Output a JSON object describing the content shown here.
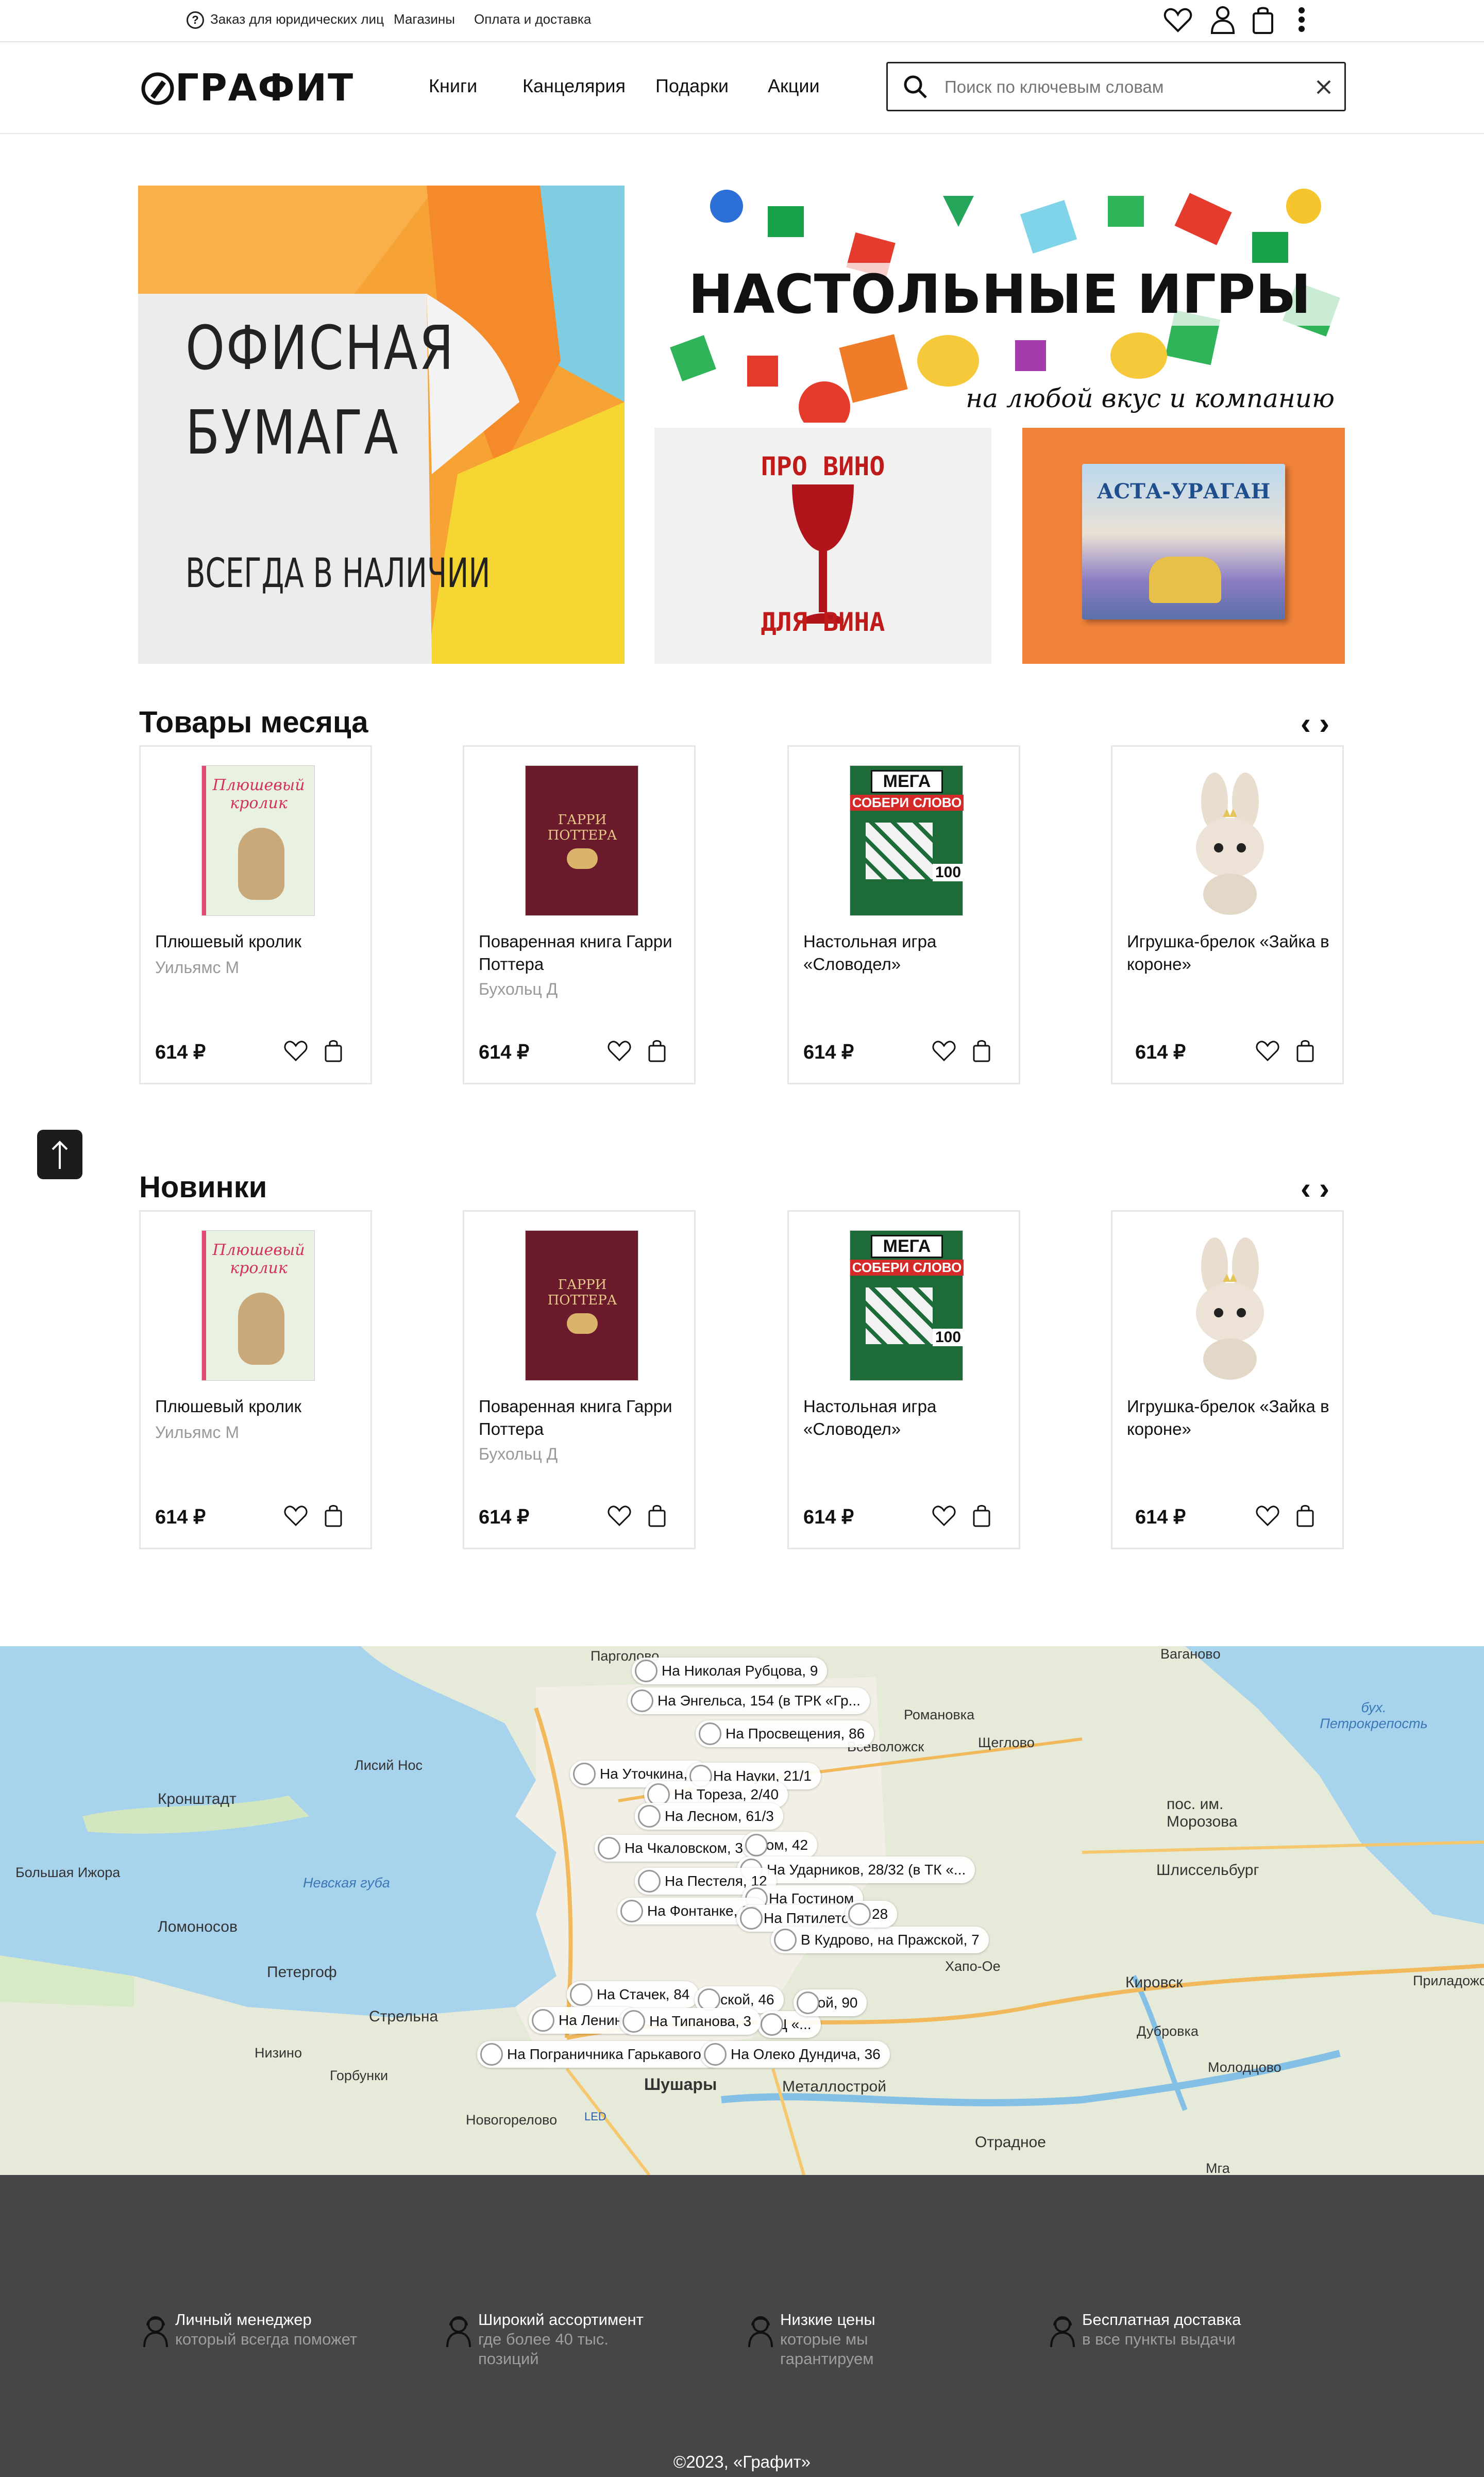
{
  "topbar": {
    "links": [
      "Заказ для юридических лиц",
      "Магазины",
      "Оплата и доставка"
    ]
  },
  "header": {
    "logo": "ГРАФИТ",
    "nav": [
      "Книги",
      "Канцелярия",
      "Подарки",
      "Акции"
    ],
    "search_placeholder": "Поиск по ключевым словам"
  },
  "banners": {
    "paper": {
      "line1": "ОФИСНАЯ",
      "line2": "БУМАГА",
      "line3": "ВСЕГДА В НАЛИЧИИ"
    },
    "games": {
      "title": "НАСТОЛЬНЫЕ ИГРЫ",
      "subtitle": "на любой вкус и компанию"
    },
    "wine": {
      "top": "ПРО ВИНО",
      "bottom": "ДЛЯ ВИНА"
    },
    "book": {
      "title": "АСТА-УРАГАН"
    }
  },
  "sections": [
    {
      "title": "Товары месяца",
      "products": [
        {
          "name": "Плюшевый кролик",
          "author": "Уильямс М",
          "price": "614 ₽",
          "cover_title": "Плюшевый кролик"
        },
        {
          "name": "Поваренная книга Гарри Поттера",
          "author": "Бухольц Д",
          "price": "614 ₽",
          "cover_title": "ГАРРИ ПОТТЕРА"
        },
        {
          "name": "Настольная игра «Словодел»",
          "author": "",
          "price": "614 ₽",
          "cover_title": "МЕГА",
          "cover_sub": "СОБЕРИ СЛОВО",
          "cover_num": "100"
        },
        {
          "name": "Игрушка-брелок «Зайка в короне»",
          "author": "",
          "price": "614 ₽"
        }
      ]
    },
    {
      "title": "Новинки",
      "products": [
        {
          "name": "Плюшевый кролик",
          "author": "Уильямс М",
          "price": "614 ₽",
          "cover_title": "Плюшевый кролик"
        },
        {
          "name": "Поваренная книга Гарри Поттера",
          "author": "Бухольц Д",
          "price": "614 ₽",
          "cover_title": "ГАРРИ ПОТТЕРА"
        },
        {
          "name": "Настольная игра «Словодел»",
          "author": "",
          "price": "614 ₽",
          "cover_title": "МЕГА",
          "cover_sub": "СОБЕРИ СЛОВО",
          "cover_num": "100"
        },
        {
          "name": "Игрушка-брелок «Зайка в короне»",
          "author": "",
          "price": "614 ₽"
        }
      ]
    }
  ],
  "map": {
    "places": [
      "Парголово",
      "Вагановo",
      "Кронштадт",
      "Лисий Нос",
      "Романовка",
      "Всеволожск",
      "Щеглово",
      "бух. Петрокрепость",
      "пос. им. Морозова",
      "Шлиссельбург",
      "Невская губа",
      "Большая Ижора",
      "Ломоносов",
      "Петергоф",
      "Стрельна",
      "Кировск",
      "Низино",
      "Горбунки",
      "Шушары",
      "Металлострой",
      "Отрадное",
      "Новогорелово",
      "Молодцово",
      "Дубровка",
      "Приладожский",
      "Хапо-Ое",
      "Мга",
      "LED"
    ],
    "stores": [
      "На Николая Рубцова, 9",
      "На Энгельса, 154 (в ТРК «Гр...",
      "На Просвещения, 86",
      "На Уточкина, 7",
      "На Науки, 21/1",
      "На Тореза, 2/40",
      "На Лесном, 61/3",
      "На Чкаловском, 36",
      "ском, 42",
      "На Ударников, 28/32 (в ТК «...",
      "На Пестеля, 12",
      "На Гостином",
      "На Фонтанке, 93",
      "На Пятилеток, 2",
      "В Кудрово, на Пражской, 7",
      "На Стачек, 84",
      "авской, 46",
      "ТЦ «...",
      "На Ленина",
      "На Типанова, 3",
      "На Пограничника Гарькавого...",
      "На Олеко Дундича, 36",
      "ской, 90",
      "28"
    ]
  },
  "footer": {
    "features": [
      {
        "title": "Личный менеджер",
        "subtitle": "который всегда поможет"
      },
      {
        "title": "Широкий ассортимент",
        "subtitle": "где более 40 тыс. позиций"
      },
      {
        "title": "Низкие цены",
        "subtitle": "которые мы гарантируем"
      },
      {
        "title": "Бесплатная доставка",
        "subtitle": "в все пункты выдачи"
      }
    ],
    "copyright": "©2023, «Графит»"
  }
}
